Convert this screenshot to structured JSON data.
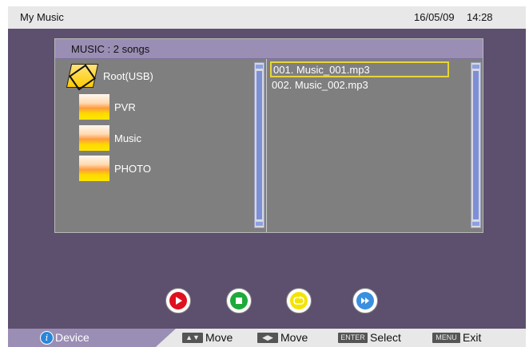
{
  "titlebar": {
    "title": "My Music",
    "date": "16/05/09",
    "time": "14:28"
  },
  "browser": {
    "header": "MUSIC : 2 songs",
    "folders": [
      {
        "label": "Root(USB)",
        "icon": "root-folder-icon"
      },
      {
        "label": "PVR",
        "icon": "folder-icon"
      },
      {
        "label": "Music",
        "icon": "folder-icon"
      },
      {
        "label": "PHOTO",
        "icon": "folder-icon"
      }
    ],
    "files": [
      "001.  Music_001.mp3",
      "002.  Music_002.mp3"
    ],
    "selected_file_index": 0
  },
  "controls": [
    {
      "name": "play",
      "icon": "play-icon",
      "color": "#e0101e"
    },
    {
      "name": "stop",
      "icon": "stop-icon",
      "color": "#1eaa3a"
    },
    {
      "name": "repeat",
      "icon": "repeat-icon",
      "color": "#f3e400"
    },
    {
      "name": "fast-forward",
      "icon": "fast-forward-icon",
      "color": "#3a8fe0"
    }
  ],
  "bottombar": {
    "device_label": "Device",
    "hints": [
      {
        "key": "▲▼",
        "label": "Move"
      },
      {
        "key": "◀▶",
        "label": "Move"
      },
      {
        "key": "ENTER",
        "label": "Select"
      },
      {
        "key": "MENU",
        "label": "Exit"
      }
    ]
  },
  "colors": {
    "background": "#5d4f6e",
    "header": "#9a8eb5",
    "pane": "#807f80",
    "selection": "#e8d43a"
  }
}
